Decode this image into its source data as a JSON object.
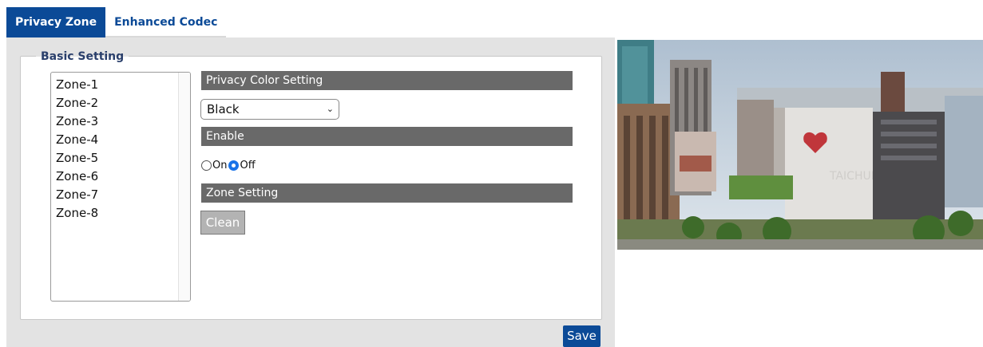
{
  "tabs": [
    {
      "label": "Privacy Zone",
      "active": true
    },
    {
      "label": "Enhanced Codec",
      "active": false
    }
  ],
  "basic_setting": {
    "legend": "Basic Setting",
    "zones": [
      "Zone-1",
      "Zone-2",
      "Zone-3",
      "Zone-4",
      "Zone-5",
      "Zone-6",
      "Zone-7",
      "Zone-8"
    ]
  },
  "privacy_color": {
    "header": "Privacy Color Setting",
    "selected": "Black"
  },
  "enable": {
    "header": "Enable",
    "on_label": "On",
    "off_label": "Off",
    "value": "Off"
  },
  "zone_setting": {
    "header": "Zone Setting",
    "clean_label": "Clean"
  },
  "save_label": "Save",
  "colors": {
    "accent": "#0b4a97",
    "section_bar": "#696969",
    "radio_checked": "#1a73e8"
  }
}
